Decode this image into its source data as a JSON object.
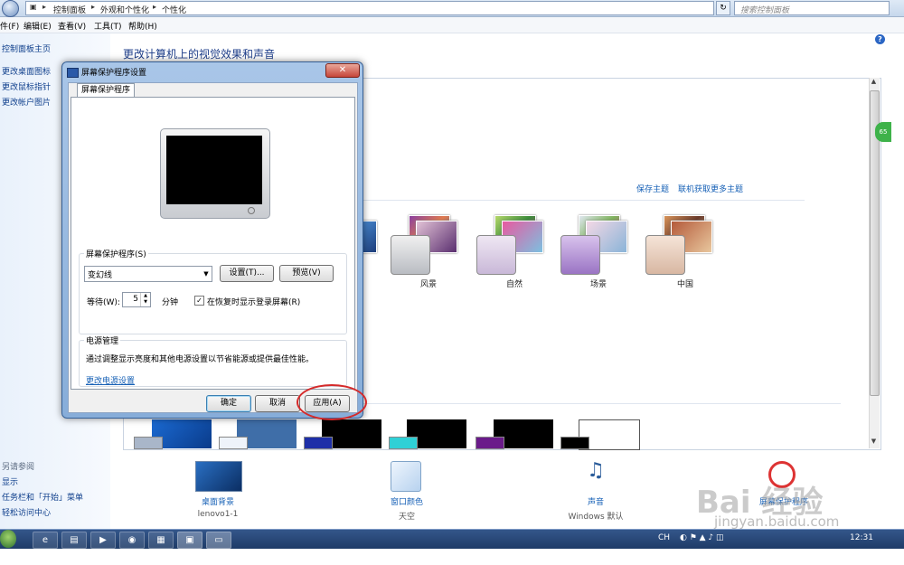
{
  "address": {
    "crumbs": [
      "控制面板",
      "外观和个性化",
      "个性化"
    ],
    "search_placeholder": "搜索控制面板"
  },
  "menu": {
    "items": [
      "件(F)",
      "编辑(E)",
      "查看(V)",
      "工具(T)",
      "帮助(H)"
    ]
  },
  "leftpane": {
    "home": "控制面板主页",
    "links": [
      "更改桌面图标",
      "更改鼠标指针",
      "更改帐户图片"
    ],
    "see_also": "另请参阅",
    "see_links": [
      "显示",
      "任务栏和「开始」菜单",
      "轻松访问中心"
    ]
  },
  "main": {
    "title": "更改计算机上的视觉效果和声音",
    "save_theme": "保存主题",
    "get_more": "联机获取更多主题",
    "themes": [
      "风景",
      "自然",
      "场景",
      "中国"
    ],
    "badge": "65"
  },
  "options": [
    {
      "label": "桌面背景",
      "sub": "lenovo1-1"
    },
    {
      "label": "窗口颜色",
      "sub": "天空"
    },
    {
      "label": "声音",
      "sub": "Windows 默认"
    },
    {
      "label": "屏幕保护程序",
      "sub": ""
    }
  ],
  "dialog": {
    "title": "屏幕保护程序设置",
    "tab": "屏幕保护程序",
    "group_label": "屏幕保护程序(S)",
    "selected": "变幻线",
    "settings_btn": "设置(T)...",
    "preview_btn": "预览(V)",
    "wait_label": "等待(W):",
    "wait_value": "5",
    "wait_unit": "分钟",
    "resume_label": "在恢复时显示登录屏幕(R)",
    "resume_checked": true,
    "power_label": "电源管理",
    "power_desc": "通过调整显示亮度和其他电源设置以节省能源或提供最佳性能。",
    "power_link": "更改电源设置",
    "ok": "确定",
    "cancel": "取消",
    "apply": "应用(A)"
  },
  "taskbar": {
    "time": "12:31",
    "tray_text": "CH"
  },
  "watermark": {
    "logo": "Bai 经验",
    "url": "jingyan.baidu.com"
  }
}
